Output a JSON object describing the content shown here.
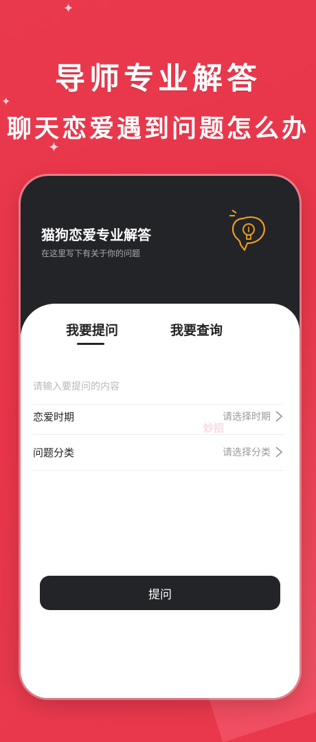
{
  "promo": {
    "headline": "导师专业解答",
    "subheadline": "聊天恋爱遇到问题怎么办"
  },
  "header": {
    "title": "猫狗恋爱专业解答",
    "subtitle": "在这里写下有关于你的问题",
    "icon": "lightbulb-icon"
  },
  "tabs": [
    {
      "label": "我要提问",
      "active": true
    },
    {
      "label": "我要查询",
      "active": false
    }
  ],
  "form": {
    "question_placeholder": "请输入要提问的内容",
    "period_label": "恋爱时期",
    "period_value": "请选择时期",
    "category_label": "问题分类",
    "category_value": "请选择分类",
    "submit_label": "提问"
  },
  "watermark": "妙招",
  "colors": {
    "brand_red": "#e9394d",
    "dark": "#232427",
    "accent_orange": "#f0a020"
  }
}
